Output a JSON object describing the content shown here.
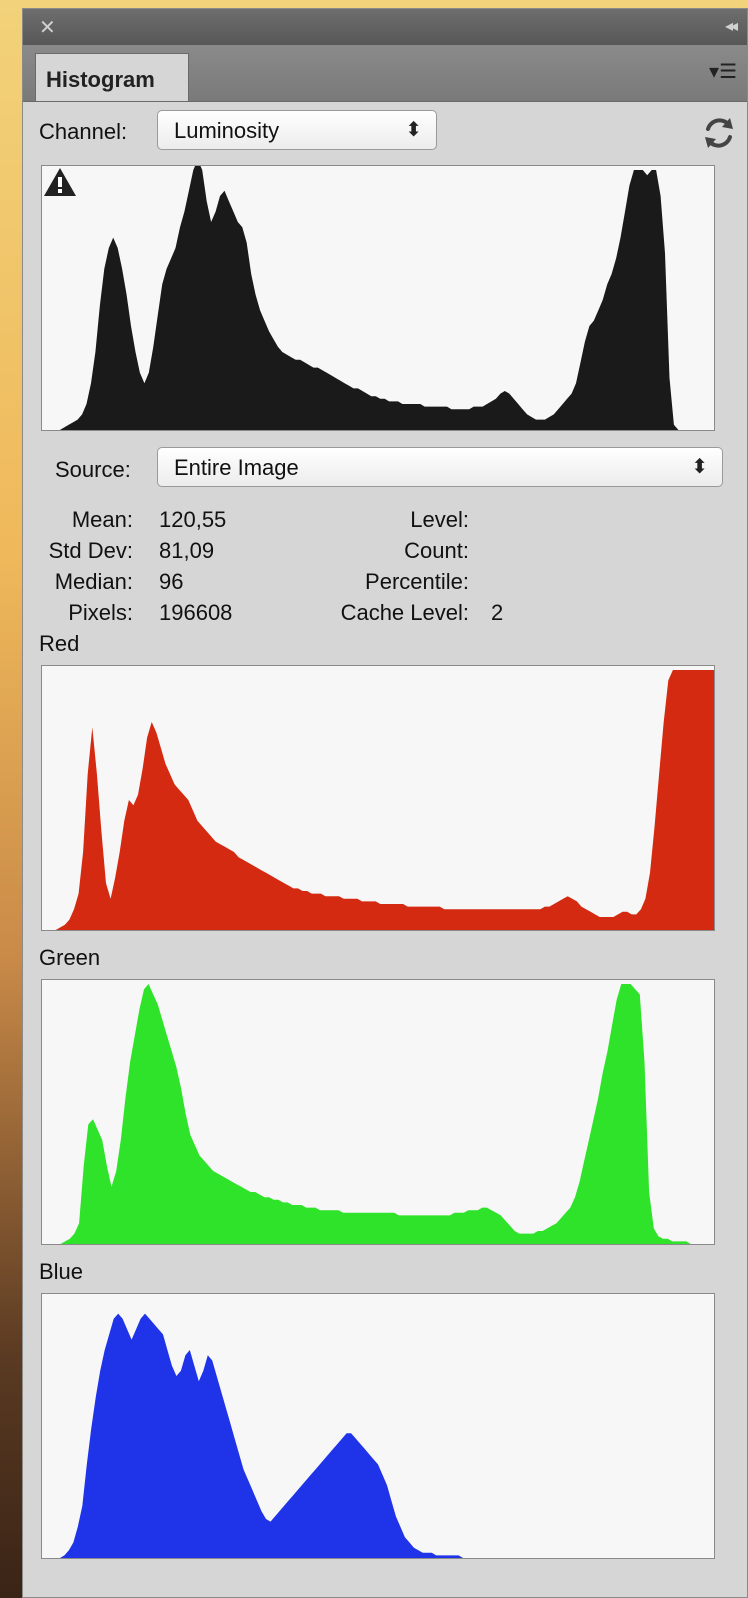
{
  "window": {
    "close_glyph": "✕",
    "collapse_glyph": "◂◂"
  },
  "tab": {
    "label": "Histogram"
  },
  "channel": {
    "label": "Channel:",
    "value": "Luminosity"
  },
  "source": {
    "label": "Source:",
    "value": "Entire Image"
  },
  "stats": {
    "mean_label": "Mean:",
    "mean": "120,55",
    "stddev_label": "Std Dev:",
    "stddev": "81,09",
    "median_label": "Median:",
    "median": "96",
    "pixels_label": "Pixels:",
    "pixels": "196608",
    "level_label": "Level:",
    "level": "",
    "count_label": "Count:",
    "count": "",
    "percentile_label": "Percentile:",
    "percentile": "",
    "cache_level_label": "Cache Level:",
    "cache_level": "2"
  },
  "histograms": [
    {
      "label": "",
      "channel": "luminosity",
      "color": "#1a1a1a",
      "values": [
        0,
        0,
        0,
        0,
        0,
        1,
        2,
        3,
        4,
        6,
        10,
        18,
        30,
        48,
        62,
        70,
        74,
        70,
        62,
        52,
        40,
        30,
        22,
        18,
        22,
        32,
        44,
        56,
        62,
        66,
        70,
        78,
        84,
        92,
        100,
        104,
        100,
        88,
        80,
        84,
        90,
        92,
        88,
        84,
        80,
        78,
        72,
        60,
        52,
        46,
        42,
        38,
        35,
        32,
        30,
        29,
        28,
        27,
        27,
        26,
        25,
        24,
        24,
        23,
        22,
        21,
        20,
        19,
        18,
        17,
        16,
        16,
        15,
        14,
        13,
        13,
        12,
        12,
        11,
        11,
        11,
        10,
        10,
        10,
        10,
        10,
        9,
        9,
        9,
        9,
        9,
        9,
        8,
        8,
        8,
        8,
        8,
        9,
        9,
        9,
        10,
        11,
        12,
        14,
        15,
        14,
        12,
        10,
        8,
        6,
        5,
        4,
        4,
        4,
        5,
        6,
        8,
        10,
        12,
        14,
        18,
        26,
        34,
        40,
        42,
        46,
        50,
        56,
        60,
        66,
        74,
        84,
        94,
        100,
        100,
        100,
        98,
        100,
        100,
        90,
        68,
        20,
        2,
        0,
        0,
        0,
        0,
        0,
        0,
        0,
        0,
        0
      ]
    },
    {
      "label": "Red",
      "channel": "red",
      "color": "#d42a12",
      "values": [
        0,
        0,
        0,
        0,
        1,
        2,
        4,
        8,
        14,
        30,
        60,
        78,
        60,
        38,
        18,
        12,
        20,
        30,
        42,
        50,
        48,
        52,
        62,
        74,
        80,
        76,
        70,
        64,
        60,
        56,
        54,
        52,
        50,
        46,
        42,
        40,
        38,
        36,
        34,
        33,
        32,
        31,
        30,
        28,
        27,
        26,
        25,
        24,
        23,
        22,
        21,
        20,
        19,
        18,
        17,
        16,
        16,
        15,
        15,
        14,
        14,
        14,
        13,
        13,
        13,
        13,
        12,
        12,
        12,
        12,
        11,
        11,
        11,
        11,
        10,
        10,
        10,
        10,
        10,
        10,
        9,
        9,
        9,
        9,
        9,
        9,
        9,
        9,
        8,
        8,
        8,
        8,
        8,
        8,
        8,
        8,
        8,
        8,
        8,
        8,
        8,
        8,
        8,
        8,
        8,
        8,
        8,
        8,
        8,
        8,
        9,
        9,
        10,
        11,
        12,
        13,
        12,
        11,
        9,
        8,
        7,
        6,
        5,
        5,
        5,
        5,
        6,
        7,
        7,
        6,
        6,
        8,
        12,
        22,
        40,
        60,
        80,
        96,
        100,
        100,
        100,
        100,
        100,
        100,
        100,
        100,
        100,
        100
      ]
    },
    {
      "label": "Green",
      "channel": "green",
      "color": "#2fe22a",
      "values": [
        0,
        0,
        0,
        0,
        0,
        1,
        2,
        4,
        8,
        30,
        46,
        48,
        44,
        40,
        30,
        22,
        28,
        40,
        56,
        70,
        80,
        90,
        98,
        100,
        96,
        92,
        86,
        80,
        74,
        68,
        60,
        50,
        42,
        38,
        34,
        32,
        30,
        28,
        27,
        26,
        25,
        24,
        23,
        22,
        21,
        20,
        20,
        19,
        18,
        18,
        17,
        17,
        16,
        16,
        15,
        15,
        15,
        14,
        14,
        14,
        13,
        13,
        13,
        13,
        13,
        12,
        12,
        12,
        12,
        12,
        12,
        12,
        12,
        12,
        12,
        12,
        12,
        11,
        11,
        11,
        11,
        11,
        11,
        11,
        11,
        11,
        11,
        11,
        11,
        12,
        12,
        12,
        13,
        13,
        13,
        14,
        14,
        13,
        12,
        11,
        9,
        7,
        5,
        4,
        4,
        4,
        4,
        5,
        5,
        6,
        7,
        8,
        10,
        12,
        14,
        18,
        24,
        32,
        40,
        48,
        56,
        66,
        74,
        84,
        94,
        100,
        100,
        100,
        98,
        96,
        70,
        20,
        6,
        3,
        2,
        2,
        1,
        1,
        1,
        1,
        0,
        0,
        0,
        0,
        0,
        0
      ]
    },
    {
      "label": "Blue",
      "channel": "blue",
      "color": "#1f34e8",
      "values": [
        0,
        0,
        0,
        0,
        0,
        1,
        3,
        6,
        12,
        20,
        36,
        50,
        62,
        72,
        80,
        86,
        92,
        94,
        92,
        88,
        84,
        88,
        92,
        94,
        92,
        90,
        88,
        86,
        80,
        74,
        70,
        72,
        78,
        80,
        74,
        68,
        72,
        78,
        76,
        70,
        64,
        58,
        52,
        46,
        40,
        34,
        30,
        26,
        22,
        18,
        15,
        14,
        16,
        18,
        20,
        22,
        24,
        26,
        28,
        30,
        32,
        34,
        36,
        38,
        40,
        42,
        44,
        46,
        48,
        48,
        46,
        44,
        42,
        40,
        38,
        36,
        32,
        28,
        22,
        16,
        12,
        8,
        6,
        4,
        3,
        2,
        2,
        2,
        1,
        1,
        1,
        1,
        1,
        1,
        0,
        0,
        0,
        0,
        0,
        0,
        0,
        0,
        0,
        0,
        0,
        0,
        0,
        0,
        0,
        0,
        0,
        0,
        0,
        0,
        0,
        0,
        0,
        0,
        0,
        0,
        0,
        0,
        0,
        0,
        0,
        0,
        0,
        0,
        0,
        0,
        0,
        0,
        0,
        0,
        0,
        0,
        0,
        0,
        0,
        0,
        0,
        0,
        0,
        0,
        0,
        0,
        0,
        0,
        0,
        0,
        0
      ]
    }
  ]
}
